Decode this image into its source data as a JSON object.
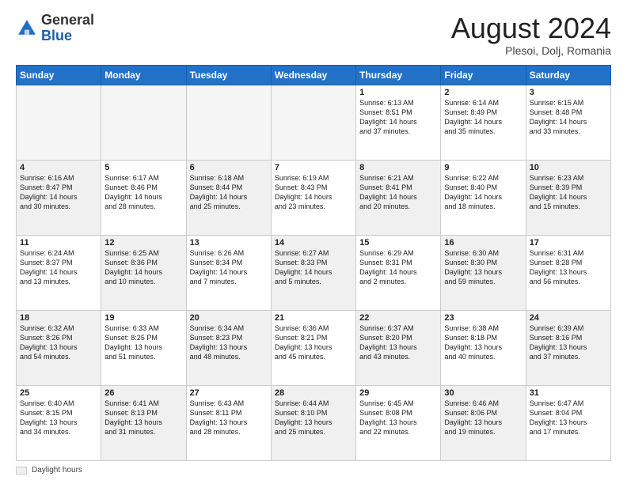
{
  "header": {
    "logo_general": "General",
    "logo_blue": "Blue",
    "month_title": "August 2024",
    "location": "Plesoi, Dolj, Romania"
  },
  "legend": {
    "label": "Daylight hours"
  },
  "days_of_week": [
    "Sunday",
    "Monday",
    "Tuesday",
    "Wednesday",
    "Thursday",
    "Friday",
    "Saturday"
  ],
  "weeks": [
    {
      "cells": [
        {
          "empty": true
        },
        {
          "empty": true
        },
        {
          "empty": true
        },
        {
          "empty": true
        },
        {
          "num": "1",
          "info": "Sunrise: 6:13 AM\nSunset: 8:51 PM\nDaylight: 14 hours\nand 37 minutes."
        },
        {
          "num": "2",
          "info": "Sunrise: 6:14 AM\nSunset: 8:49 PM\nDaylight: 14 hours\nand 35 minutes."
        },
        {
          "num": "3",
          "info": "Sunrise: 6:15 AM\nSunset: 8:48 PM\nDaylight: 14 hours\nand 33 minutes."
        }
      ]
    },
    {
      "cells": [
        {
          "num": "4",
          "shaded": true,
          "info": "Sunrise: 6:16 AM\nSunset: 8:47 PM\nDaylight: 14 hours\nand 30 minutes."
        },
        {
          "num": "5",
          "info": "Sunrise: 6:17 AM\nSunset: 8:46 PM\nDaylight: 14 hours\nand 28 minutes."
        },
        {
          "num": "6",
          "shaded": true,
          "info": "Sunrise: 6:18 AM\nSunset: 8:44 PM\nDaylight: 14 hours\nand 25 minutes."
        },
        {
          "num": "7",
          "info": "Sunrise: 6:19 AM\nSunset: 8:43 PM\nDaylight: 14 hours\nand 23 minutes."
        },
        {
          "num": "8",
          "shaded": true,
          "info": "Sunrise: 6:21 AM\nSunset: 8:41 PM\nDaylight: 14 hours\nand 20 minutes."
        },
        {
          "num": "9",
          "info": "Sunrise: 6:22 AM\nSunset: 8:40 PM\nDaylight: 14 hours\nand 18 minutes."
        },
        {
          "num": "10",
          "shaded": true,
          "info": "Sunrise: 6:23 AM\nSunset: 8:39 PM\nDaylight: 14 hours\nand 15 minutes."
        }
      ]
    },
    {
      "cells": [
        {
          "num": "11",
          "info": "Sunrise: 6:24 AM\nSunset: 8:37 PM\nDaylight: 14 hours\nand 13 minutes."
        },
        {
          "num": "12",
          "shaded": true,
          "info": "Sunrise: 6:25 AM\nSunset: 8:36 PM\nDaylight: 14 hours\nand 10 minutes."
        },
        {
          "num": "13",
          "info": "Sunrise: 6:26 AM\nSunset: 8:34 PM\nDaylight: 14 hours\nand 7 minutes."
        },
        {
          "num": "14",
          "shaded": true,
          "info": "Sunrise: 6:27 AM\nSunset: 8:33 PM\nDaylight: 14 hours\nand 5 minutes."
        },
        {
          "num": "15",
          "info": "Sunrise: 6:29 AM\nSunset: 8:31 PM\nDaylight: 14 hours\nand 2 minutes."
        },
        {
          "num": "16",
          "shaded": true,
          "info": "Sunrise: 6:30 AM\nSunset: 8:30 PM\nDaylight: 13 hours\nand 59 minutes."
        },
        {
          "num": "17",
          "info": "Sunrise: 6:31 AM\nSunset: 8:28 PM\nDaylight: 13 hours\nand 56 minutes."
        }
      ]
    },
    {
      "cells": [
        {
          "num": "18",
          "shaded": true,
          "info": "Sunrise: 6:32 AM\nSunset: 8:26 PM\nDaylight: 13 hours\nand 54 minutes."
        },
        {
          "num": "19",
          "info": "Sunrise: 6:33 AM\nSunset: 8:25 PM\nDaylight: 13 hours\nand 51 minutes."
        },
        {
          "num": "20",
          "shaded": true,
          "info": "Sunrise: 6:34 AM\nSunset: 8:23 PM\nDaylight: 13 hours\nand 48 minutes."
        },
        {
          "num": "21",
          "info": "Sunrise: 6:36 AM\nSunset: 8:21 PM\nDaylight: 13 hours\nand 45 minutes."
        },
        {
          "num": "22",
          "shaded": true,
          "info": "Sunrise: 6:37 AM\nSunset: 8:20 PM\nDaylight: 13 hours\nand 43 minutes."
        },
        {
          "num": "23",
          "info": "Sunrise: 6:38 AM\nSunset: 8:18 PM\nDaylight: 13 hours\nand 40 minutes."
        },
        {
          "num": "24",
          "shaded": true,
          "info": "Sunrise: 6:39 AM\nSunset: 8:16 PM\nDaylight: 13 hours\nand 37 minutes."
        }
      ]
    },
    {
      "cells": [
        {
          "num": "25",
          "info": "Sunrise: 6:40 AM\nSunset: 8:15 PM\nDaylight: 13 hours\nand 34 minutes."
        },
        {
          "num": "26",
          "shaded": true,
          "info": "Sunrise: 6:41 AM\nSunset: 8:13 PM\nDaylight: 13 hours\nand 31 minutes."
        },
        {
          "num": "27",
          "info": "Sunrise: 6:43 AM\nSunset: 8:11 PM\nDaylight: 13 hours\nand 28 minutes."
        },
        {
          "num": "28",
          "shaded": true,
          "info": "Sunrise: 6:44 AM\nSunset: 8:10 PM\nDaylight: 13 hours\nand 25 minutes."
        },
        {
          "num": "29",
          "info": "Sunrise: 6:45 AM\nSunset: 8:08 PM\nDaylight: 13 hours\nand 22 minutes."
        },
        {
          "num": "30",
          "shaded": true,
          "info": "Sunrise: 6:46 AM\nSunset: 8:06 PM\nDaylight: 13 hours\nand 19 minutes."
        },
        {
          "num": "31",
          "info": "Sunrise: 6:47 AM\nSunset: 8:04 PM\nDaylight: 13 hours\nand 17 minutes."
        }
      ]
    }
  ]
}
